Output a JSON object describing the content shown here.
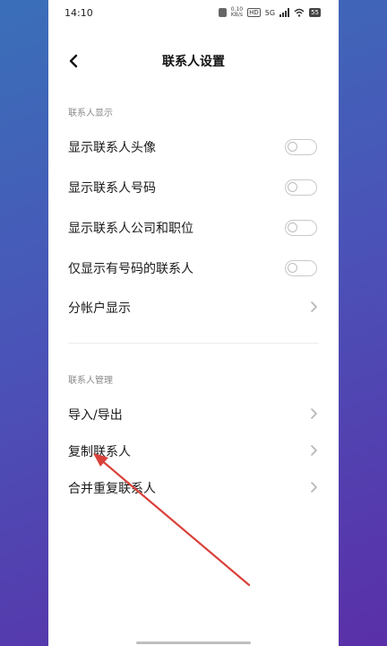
{
  "status_bar": {
    "time": "14:10",
    "speed_value": "0.10",
    "speed_unit": "KB/s",
    "hd_label": "HD",
    "network_label": "5G",
    "battery": "55"
  },
  "header": {
    "title": "联系人设置",
    "back_icon": "chevron-left-icon"
  },
  "sections": [
    {
      "title": "联系人显示",
      "items": [
        {
          "label": "显示联系人头像",
          "control": "toggle",
          "checked": false
        },
        {
          "label": "显示联系人号码",
          "control": "toggle",
          "checked": false
        },
        {
          "label": "显示联系人公司和职位",
          "control": "toggle",
          "checked": false
        },
        {
          "label": "仅显示有号码的联系人",
          "control": "toggle",
          "checked": false
        },
        {
          "label": "分帐户显示",
          "control": "chevron"
        }
      ]
    },
    {
      "title": "联系人管理",
      "items": [
        {
          "label": "导入/导出",
          "control": "chevron"
        },
        {
          "label": "复制联系人",
          "control": "chevron"
        },
        {
          "label": "合并重复联系人",
          "control": "chevron"
        }
      ]
    }
  ],
  "colors": {
    "annotation_arrow": "#d9403a",
    "background_gradient_start": "#3a6fb8",
    "background_gradient_end": "#5a2fa8"
  }
}
